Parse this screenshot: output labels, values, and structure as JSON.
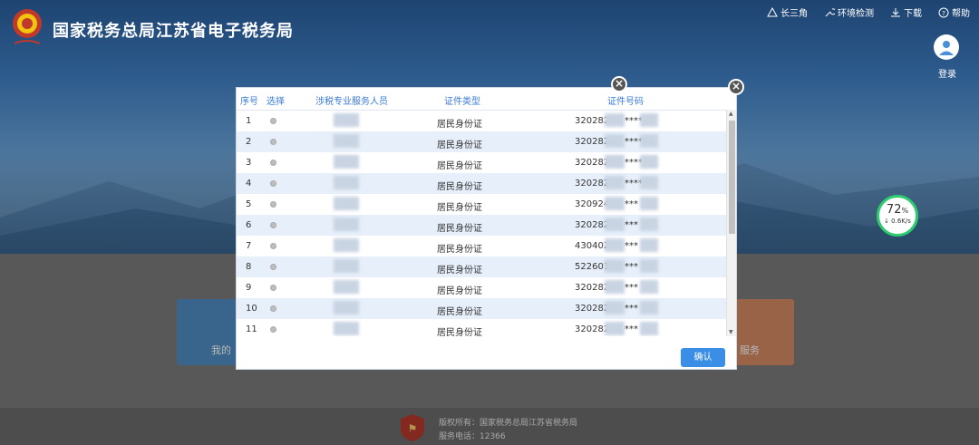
{
  "site": {
    "title": "国家税务总局江苏省电子税务局"
  },
  "topnav": [
    {
      "label": "长三角",
      "icon": "triangle-nodes-icon"
    },
    {
      "label": "环境检测",
      "icon": "wrench-icon"
    },
    {
      "label": "下载",
      "icon": "download-icon"
    },
    {
      "label": "帮助",
      "icon": "help-icon"
    }
  ],
  "login": {
    "label": "登录"
  },
  "speed": {
    "percent": "72",
    "percent_unit": "%",
    "rate": "↓ 0.6K/s"
  },
  "cards": {
    "left_text": "我的",
    "right_text": "服务"
  },
  "footer": {
    "copyright": "版权所有：国家税务总局江苏省税务局",
    "phone": "服务电话：12366"
  },
  "modal": {
    "columns": [
      "序号",
      "选择",
      "涉税专业服务人员",
      "证件类型",
      "证件号码"
    ],
    "rows": [
      {
        "no": "1",
        "type": "居民身份证",
        "id_prefix": "320282",
        "id_mask": "****"
      },
      {
        "no": "2",
        "type": "居民身份证",
        "id_prefix": "320282",
        "id_mask": "****"
      },
      {
        "no": "3",
        "type": "居民身份证",
        "id_prefix": "320282",
        "id_mask": "****"
      },
      {
        "no": "4",
        "type": "居民身份证",
        "id_prefix": "320282",
        "id_mask": "****"
      },
      {
        "no": "5",
        "type": "居民身份证",
        "id_prefix": "320924",
        "id_mask": "***"
      },
      {
        "no": "6",
        "type": "居民身份证",
        "id_prefix": "320282",
        "id_mask": "***"
      },
      {
        "no": "7",
        "type": "居民身份证",
        "id_prefix": "430402",
        "id_mask": "***"
      },
      {
        "no": "8",
        "type": "居民身份证",
        "id_prefix": "522601",
        "id_mask": "***"
      },
      {
        "no": "9",
        "type": "居民身份证",
        "id_prefix": "320282",
        "id_mask": "***"
      },
      {
        "no": "10",
        "type": "居民身份证",
        "id_prefix": "320282",
        "id_mask": "***"
      },
      {
        "no": "11",
        "type": "居民身份证",
        "id_prefix": "320282",
        "id_mask": "***"
      }
    ],
    "confirm_label": "确认",
    "close_symbol": "×"
  },
  "colors": {
    "accent": "#3a7bd5",
    "row_alt": "#e6effa",
    "progress": "#2ecc71"
  }
}
